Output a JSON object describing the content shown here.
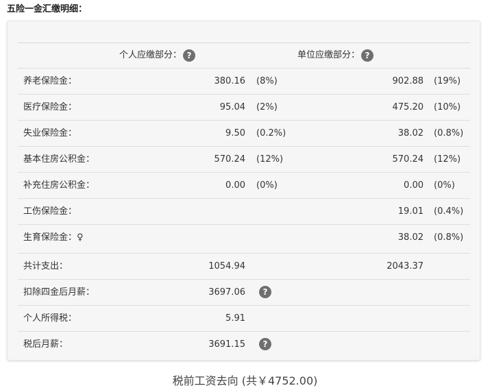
{
  "title": "五险一金汇缴明细：",
  "header": {
    "personal": "个人应缴部分：",
    "company": "单位应缴部分："
  },
  "rows": [
    {
      "label": "养老保险金：",
      "pval": "380.16",
      "prate": "(8%)",
      "cval": "902.88",
      "crate": "(19%)"
    },
    {
      "label": "医疗保险金：",
      "pval": "95.04",
      "prate": "(2%)",
      "cval": "475.20",
      "crate": "(10%)"
    },
    {
      "label": "失业保险金：",
      "pval": "9.50",
      "prate": "(0.2%)",
      "cval": "38.02",
      "crate": "(0.8%)"
    },
    {
      "label": "基本住房公积金：",
      "pval": "570.24",
      "prate": "(12%)",
      "cval": "570.24",
      "crate": "(12%)"
    },
    {
      "label": "补充住房公积金：",
      "pval": "0.00",
      "prate": "(0%)",
      "cval": "0.00",
      "crate": "(0%)"
    },
    {
      "label": "工伤保险金：",
      "pval": "",
      "prate": "",
      "cval": "19.01",
      "crate": "(0.4%)"
    },
    {
      "label": "生育保险金：♀",
      "pval": "",
      "prate": "",
      "cval": "38.02",
      "crate": "(0.8%)"
    }
  ],
  "summary": [
    {
      "label": "共计支出：",
      "pval": "1054.94",
      "cval": "2043.37"
    },
    {
      "label": "扣除四金后月薪：",
      "pval": "3697.06"
    },
    {
      "label": "个人所得税：",
      "pval": "5.91"
    },
    {
      "label": "税后月薪：",
      "pval": "3691.15"
    }
  ],
  "help_glyph": "?",
  "footer": "税前工资去向 (共￥4752.00)"
}
